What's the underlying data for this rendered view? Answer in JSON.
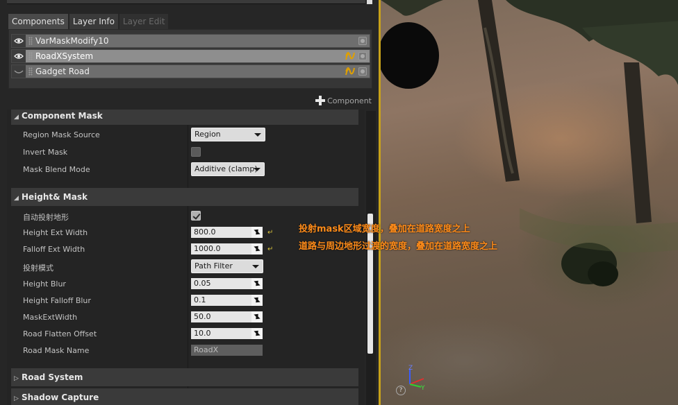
{
  "tabs": [
    {
      "label": "Components",
      "state": "active"
    },
    {
      "label": "Layer Info",
      "state": "normal"
    },
    {
      "label": "Layer Edit",
      "state": "disabled"
    }
  ],
  "layers": [
    {
      "name": "VarMaskModify10",
      "visible": true,
      "has_road_icon": false,
      "selected": false
    },
    {
      "name": "RoadXSystem",
      "visible": true,
      "has_road_icon": true,
      "selected": true
    },
    {
      "name": "Gadget Road",
      "visible": false,
      "has_road_icon": true,
      "selected": false
    }
  ],
  "add_component_label": "Component",
  "component_mask": {
    "title": "Component Mask",
    "region_mask_source": {
      "label": "Region Mask Source",
      "value": "Region"
    },
    "invert_mask": {
      "label": "Invert Mask",
      "checked": false
    },
    "mask_blend_mode": {
      "label": "Mask Blend Mode",
      "value": "Additive (clamp)"
    }
  },
  "height_mask": {
    "title": "Height& Mask",
    "auto_project_terrain": {
      "label": "自动投射地形",
      "checked": true
    },
    "height_ext_width": {
      "label": "Height Ext Width",
      "value": "800.0"
    },
    "falloff_ext_width": {
      "label": "Falloff Ext Width",
      "value": "1000.0"
    },
    "projection_mode": {
      "label": "投射模式",
      "value": "Path Filter"
    },
    "height_blur": {
      "label": "Height Blur",
      "value": "0.05"
    },
    "height_falloff_blur": {
      "label": "Height Falloff Blur",
      "value": "0.1"
    },
    "mask_ext_width": {
      "label": "MaskExtWidth",
      "value": "50.0"
    },
    "road_flatten_offset": {
      "label": "Road Flatten Offset",
      "value": "10.0"
    },
    "road_mask_name": {
      "label": "Road Mask Name",
      "value": "RoadX"
    }
  },
  "road_system": {
    "title": "Road System"
  },
  "shadow_capture": {
    "title": "Shadow Capture"
  },
  "annotations": {
    "line1": "投射mask区域宽度，叠加在道路宽度之上",
    "line2": "道路与周边地形过渡的宽度，叠加在道路宽度之上"
  },
  "gizmo": {
    "z": "Z",
    "y": "Y",
    "help": "?"
  },
  "colors": {
    "annotation": "#ff8c1a",
    "viewport_border": "#c8a21a",
    "road_icon": "#e0a000"
  }
}
